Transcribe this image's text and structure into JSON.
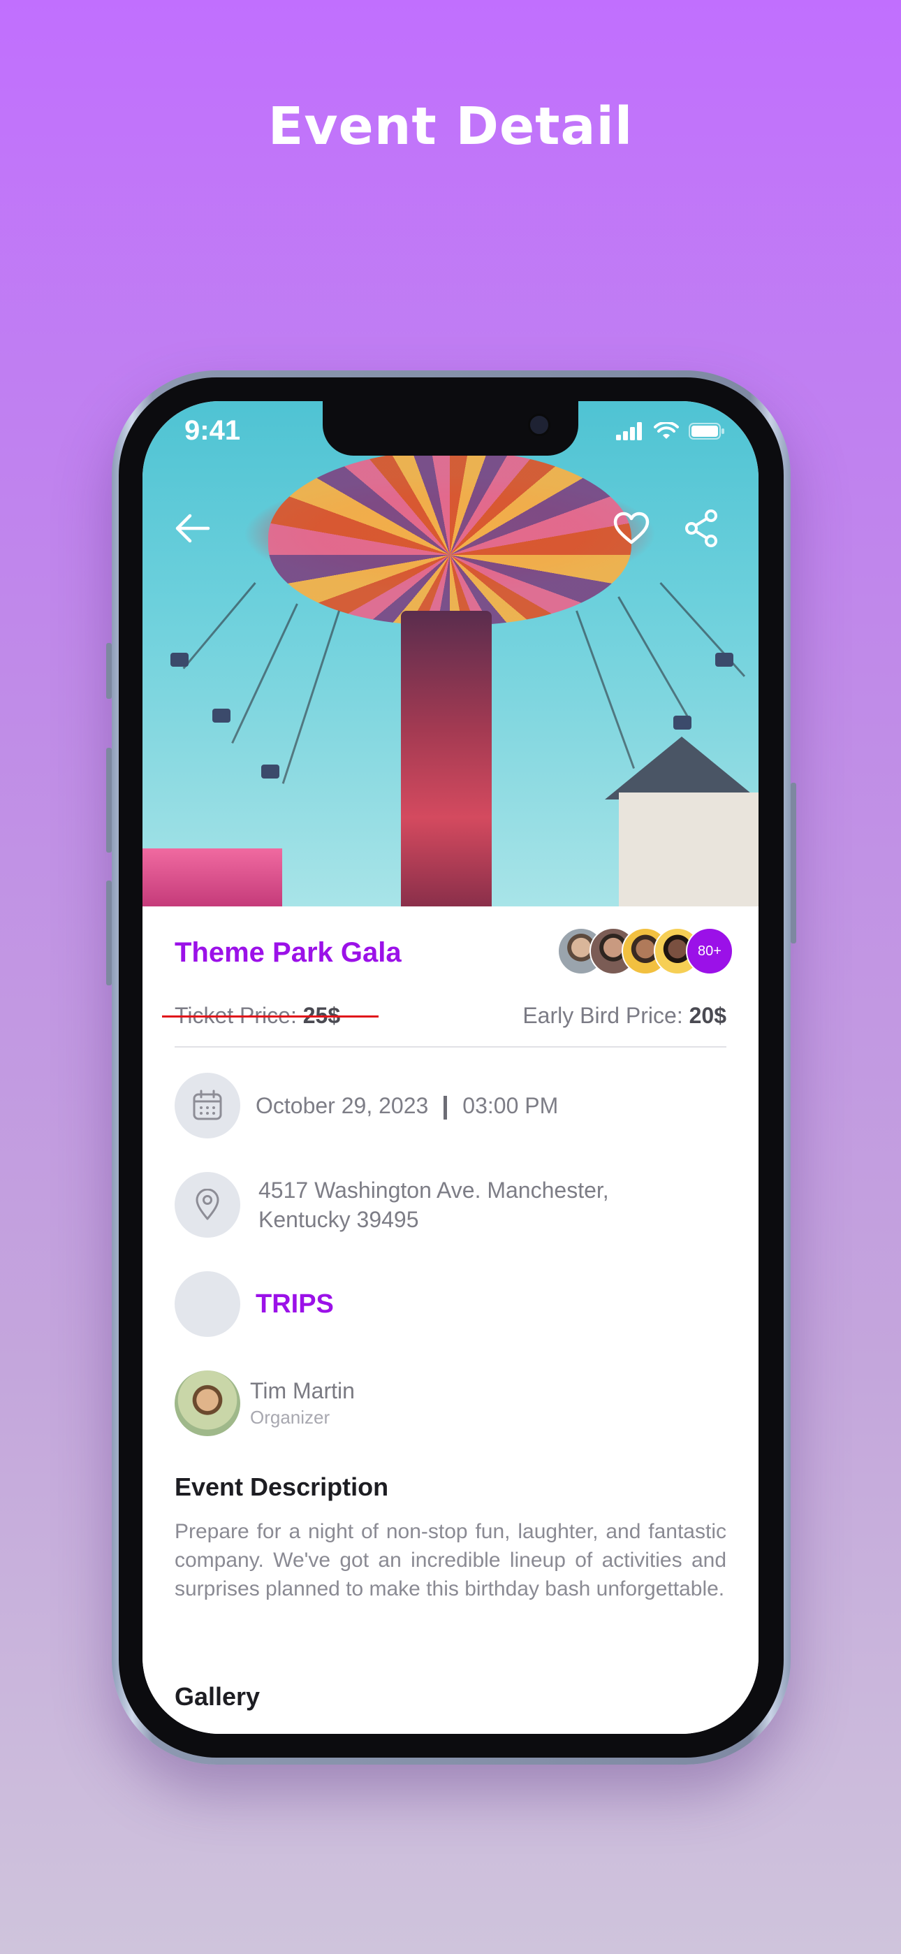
{
  "page": {
    "heading": "Event Detail"
  },
  "status_bar": {
    "time": "9:41"
  },
  "hero": {
    "icons": [
      "back-arrow-icon",
      "heart-icon",
      "share-icon"
    ]
  },
  "event": {
    "title": "Theme Park Gala",
    "attendees_more": "80+",
    "ticket_label": "Ticket Price: ",
    "ticket_value": "25$",
    "early_label": "Early Bird Price: ",
    "early_value": "20$",
    "date": "October 29, 2023",
    "time": "03:00 PM",
    "address_line1": "4517 Washington Ave. Manchester,",
    "address_line2": "Kentucky 39495",
    "category": "TRIPS",
    "organizer_name": "Tim Martin",
    "organizer_role": "Organizer"
  },
  "description": {
    "title": "Event Description",
    "text": "Prepare for a night of non-stop fun, laughter, and fantastic company. We've got an incredible lineup of activities and surprises planned to make this birthday bash unforgettable."
  },
  "gallery": {
    "title": "Gallery"
  },
  "colors": {
    "accent": "#9b11e8",
    "strike": "#e0141a",
    "background_top": "#c16ffe"
  }
}
